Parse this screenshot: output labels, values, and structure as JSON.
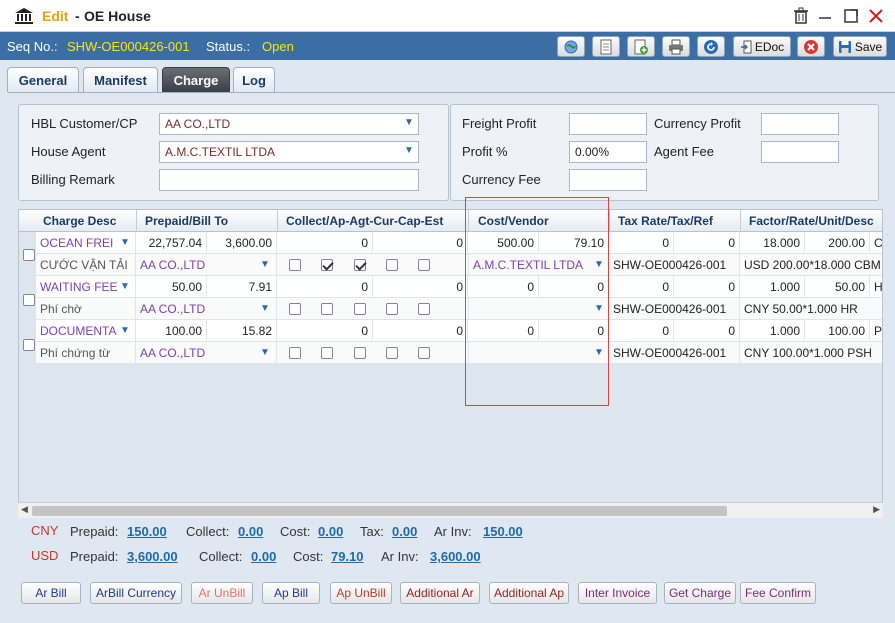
{
  "window": {
    "mode": "Edit",
    "separator": "-",
    "title": "OE House"
  },
  "header": {
    "seq_label": "Seq No.:",
    "seq_value": "SHW-OE000426-001",
    "status_label": "Status.:",
    "status_value": "Open"
  },
  "toolbar": {
    "edoc_label": "EDoc",
    "save_label": "Save"
  },
  "tabs": [
    {
      "label": "General"
    },
    {
      "label": "Manifest"
    },
    {
      "label": "Charge"
    },
    {
      "label": "Log"
    }
  ],
  "form": {
    "hbl_customer_label": "HBL Customer/CP",
    "hbl_customer_value": "AA CO.,LTD",
    "house_agent_label": "House Agent",
    "house_agent_value": "A.M.C.TEXTIL LTDA",
    "billing_remark_label": "Billing Remark",
    "billing_remark_value": "",
    "freight_profit_label": "Freight Profit",
    "freight_profit_value": "",
    "profit_pct_label": "Profit %",
    "profit_pct_value": "0.00%",
    "currency_fee_label": "Currency Fee",
    "currency_fee_value": "",
    "currency_profit_label": "Currency Profit",
    "currency_profit_value": "",
    "agent_fee_label": "Agent Fee",
    "agent_fee_value": ""
  },
  "grid": {
    "headers": [
      "Charge Desc",
      "Prepaid/Bill To",
      "Collect/Ap-Agt-Cur-Cap-Est",
      "Cost/Vendor",
      "Tax Rate/Tax/Ref",
      "Factor/Rate/Unit/Desc"
    ],
    "charges": [
      {
        "code": "OCEAN FREI",
        "desc": "CƯỚC VẬN TẢI",
        "prepaid": "22,757.04",
        "prepaid2": "3,600.00",
        "bill_to": "AA CO.,LTD",
        "collect": "0",
        "collect2": "0",
        "cost": "500.00",
        "cost2": "79.10",
        "vendor": "A.M.C.TEXTIL LTDA",
        "tax_rate": "0",
        "tax": "0",
        "ref": "SHW-OE000426-001",
        "factor": "18.000",
        "rate": "200.00",
        "unit": "C",
        "unit_desc": "USD 200.00*18.000 CBM",
        "checks": [
          false,
          true,
          true,
          false,
          false
        ]
      },
      {
        "code": "WAITING FEE",
        "desc": "Phí chờ",
        "prepaid": "50.00",
        "prepaid2": "7.91",
        "bill_to": "AA CO.,LTD",
        "collect": "0",
        "collect2": "0",
        "cost": "0",
        "cost2": "0",
        "vendor": "",
        "tax_rate": "0",
        "tax": "0",
        "ref": "SHW-OE000426-001",
        "factor": "1.000",
        "rate": "50.00",
        "unit": "H",
        "unit_desc": "CNY 50.00*1.000 HR",
        "checks": [
          false,
          false,
          false,
          false,
          false
        ]
      },
      {
        "code": "DOCUMENTA",
        "desc": "Phí chứng từ",
        "prepaid": "100.00",
        "prepaid2": "15.82",
        "bill_to": "AA CO.,LTD",
        "collect": "0",
        "collect2": "0",
        "cost": "0",
        "cost2": "0",
        "vendor": "",
        "tax_rate": "0",
        "tax": "0",
        "ref": "SHW-OE000426-001",
        "factor": "1.000",
        "rate": "100.00",
        "unit": "P",
        "unit_desc": "CNY 100.00*1.000 PSH",
        "checks": [
          false,
          false,
          false,
          false,
          false
        ]
      }
    ]
  },
  "summary": {
    "cny": {
      "currency": "CNY",
      "prepaid_label": "Prepaid:",
      "prepaid": "150.00",
      "collect_label": "Collect:",
      "collect": "0.00",
      "cost_label": "Cost:",
      "cost": "0.00",
      "tax_label": "Tax:",
      "tax": "0.00",
      "ar_inv_label": "Ar Inv:",
      "ar_inv": "150.00"
    },
    "usd": {
      "currency": "USD",
      "prepaid_label": "Prepaid:",
      "prepaid": "3,600.00",
      "collect_label": "Collect:",
      "collect": "0.00",
      "cost_label": "Cost:",
      "cost": "79.10",
      "ar_inv_label": "Ar Inv:",
      "ar_inv": "3,600.00"
    }
  },
  "buttons": [
    {
      "label": "Ar Bill",
      "color": "#1a3a9a"
    },
    {
      "label": "ArBill Currency",
      "color": "#1a3a9a"
    },
    {
      "label": "Ar UnBill",
      "color": "#e07070"
    },
    {
      "label": "Ap Bill",
      "color": "#1a3a9a"
    },
    {
      "label": "Ap UnBill",
      "color": "#c0392b"
    },
    {
      "label": "Additional Ar",
      "color": "#a02020"
    },
    {
      "label": "Additional Ap",
      "color": "#a02020"
    },
    {
      "label": "Inter Invoice",
      "color": "#7a2c7a"
    },
    {
      "label": "Get Charge",
      "color": "#7a2c7a"
    },
    {
      "label": "Fee Confirm",
      "color": "#7a2c7a"
    }
  ],
  "colors": {
    "accent": "#3b6ea5",
    "highlight_yellow": "#ffe600",
    "link_blue": "#1f6aa8",
    "selection_red": "#e04040"
  }
}
